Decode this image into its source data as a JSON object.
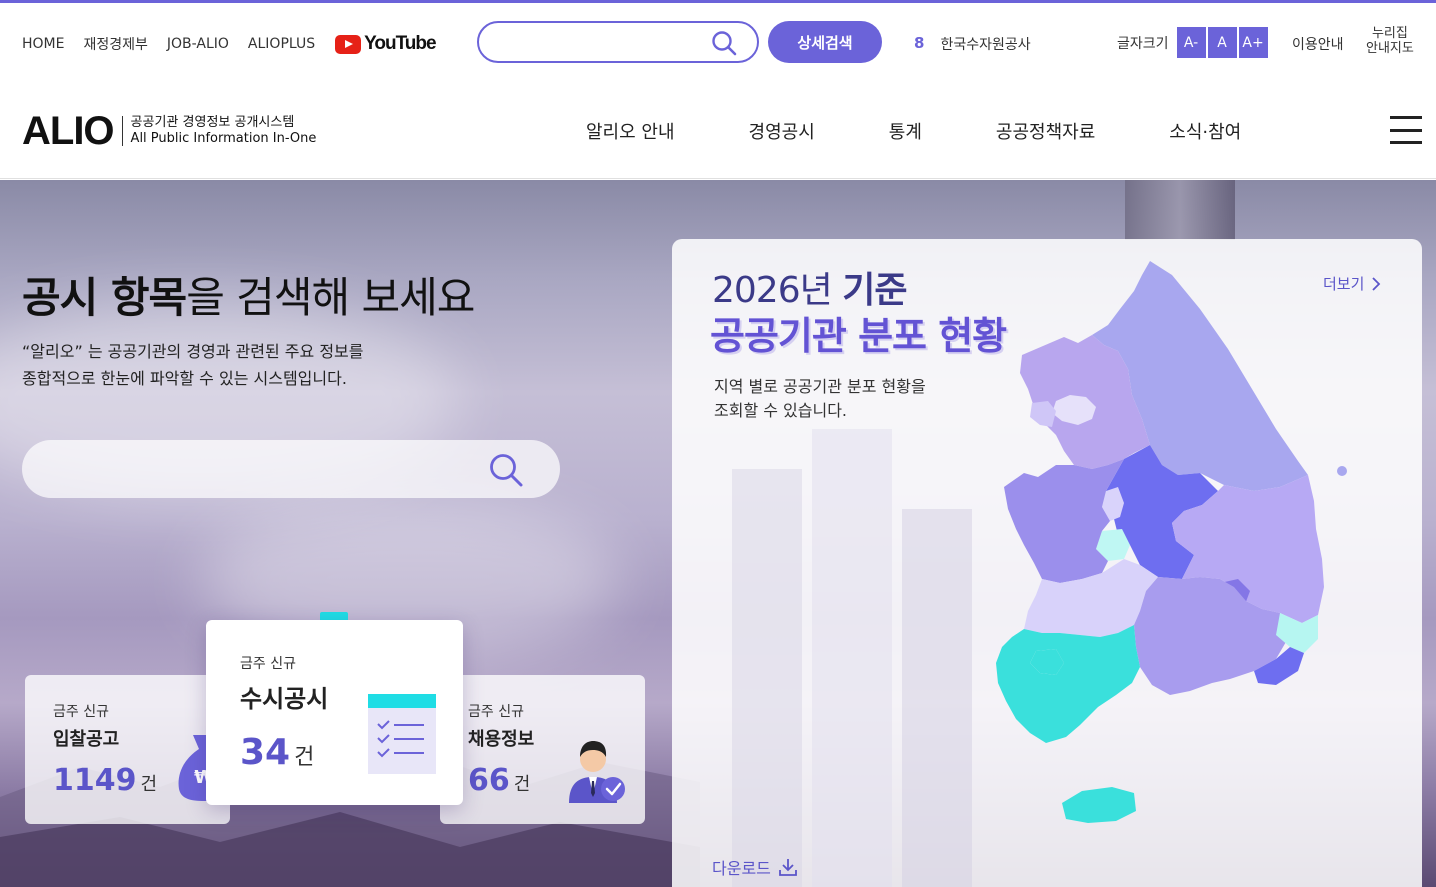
{
  "utility_links": [
    "HOME",
    "재정경제부",
    "JOB-ALIO",
    "ALIOPLUS"
  ],
  "youtube_label": "YouTube",
  "top_search": {
    "placeholder": ""
  },
  "advanced_search_label": "상세검색",
  "rank": {
    "number": "8",
    "name": "한국수자원공사"
  },
  "font_size": {
    "label": "글자크기",
    "buttons": [
      "A-",
      "A",
      "A+"
    ]
  },
  "guide_label": "이용안내",
  "sitemap_label_line1": "누리집",
  "sitemap_label_line2": "안내지도",
  "logo": {
    "main": "ALIO",
    "sub_ko": "공공기관 경영정보 공개시스템",
    "sub_en": "All Public Information In-One"
  },
  "menu": [
    "알리오 안내",
    "경영공시",
    "통계",
    "공공정책자료",
    "소식·참여"
  ],
  "hero": {
    "title_bold": "공시 항목",
    "title_rest": "을 검색해 보세요",
    "desc_line1": "“알리오” 는 공공기관의 경영과 관련된 주요 정보를",
    "desc_line2": "종합적으로 한눈에 파악할 수 있는 시스템입니다.",
    "search_placeholder": ""
  },
  "cards": [
    {
      "kicker": "금주 신규",
      "title": "입찰공고",
      "count": "1149",
      "unit": "건"
    },
    {
      "kicker": "금주 신규",
      "title": "수시공시",
      "count": "34",
      "unit": "건"
    },
    {
      "kicker": "금주 신규",
      "title": "채용정보",
      "count": "66",
      "unit": "건"
    }
  ],
  "map_panel": {
    "year": "2026년",
    "year_suffix": "기준",
    "title": "공공기관 분포 현황",
    "desc_line1": "지역 별로 공공기관 분포 현황을",
    "desc_line2": "조회할 수 있습니다.",
    "more_label": "더보기",
    "download_label": "다운로드"
  },
  "colors": {
    "accent": "#6b63d9",
    "number": "#5b55c9",
    "highlight": "#1fdde5"
  }
}
